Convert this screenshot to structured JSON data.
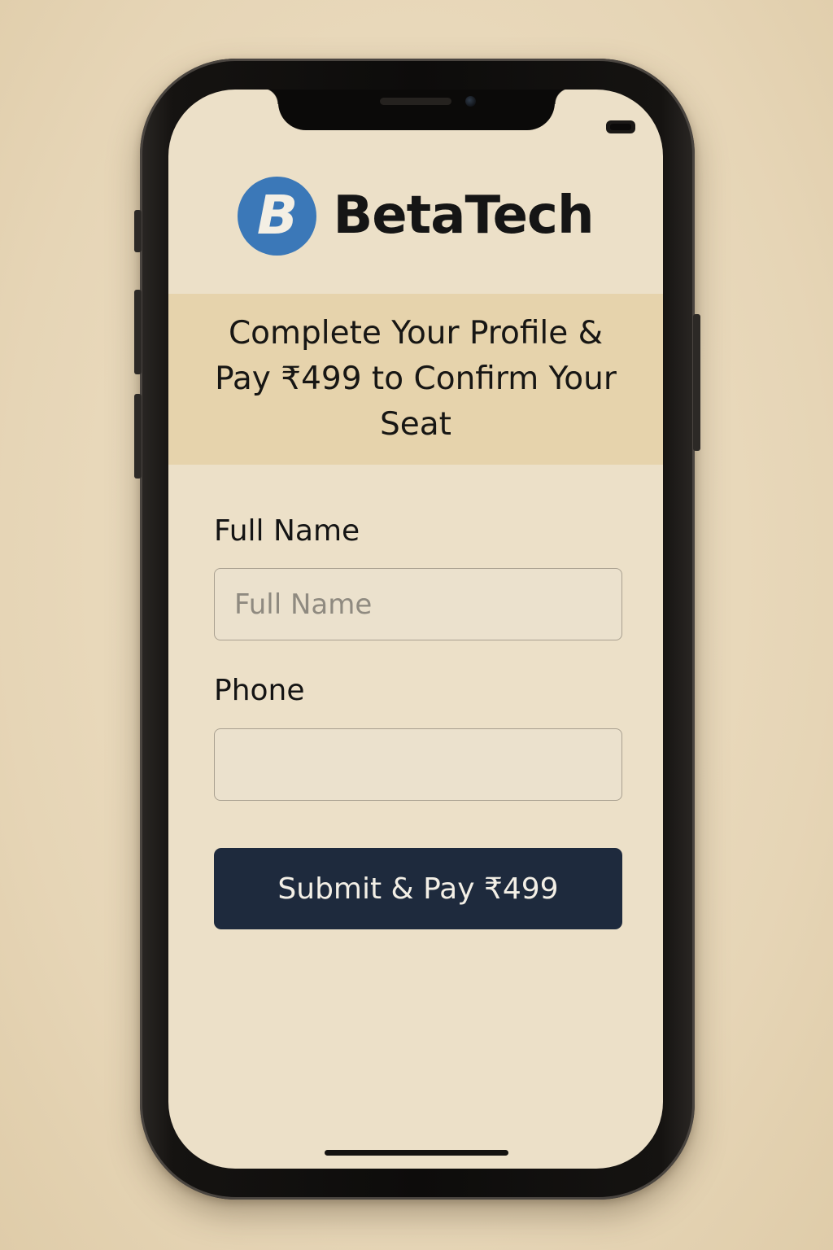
{
  "brand": {
    "logo_letter": "B",
    "name": "BetaTech",
    "logo_color": "#3b78b8"
  },
  "banner": {
    "title": "Complete Your Profile & Pay ₹499 to Confirm Your Seat",
    "background_color": "#e6d3ac"
  },
  "form": {
    "full_name": {
      "label": "Full Name",
      "placeholder": "Full Name",
      "value": ""
    },
    "phone": {
      "label": "Phone",
      "placeholder": "",
      "value": ""
    },
    "submit_label": "Submit & Pay ₹499",
    "submit_color": "#1e2a3d"
  },
  "icons": {
    "logo": "brand-logo-icon",
    "battery": "battery-icon"
  }
}
